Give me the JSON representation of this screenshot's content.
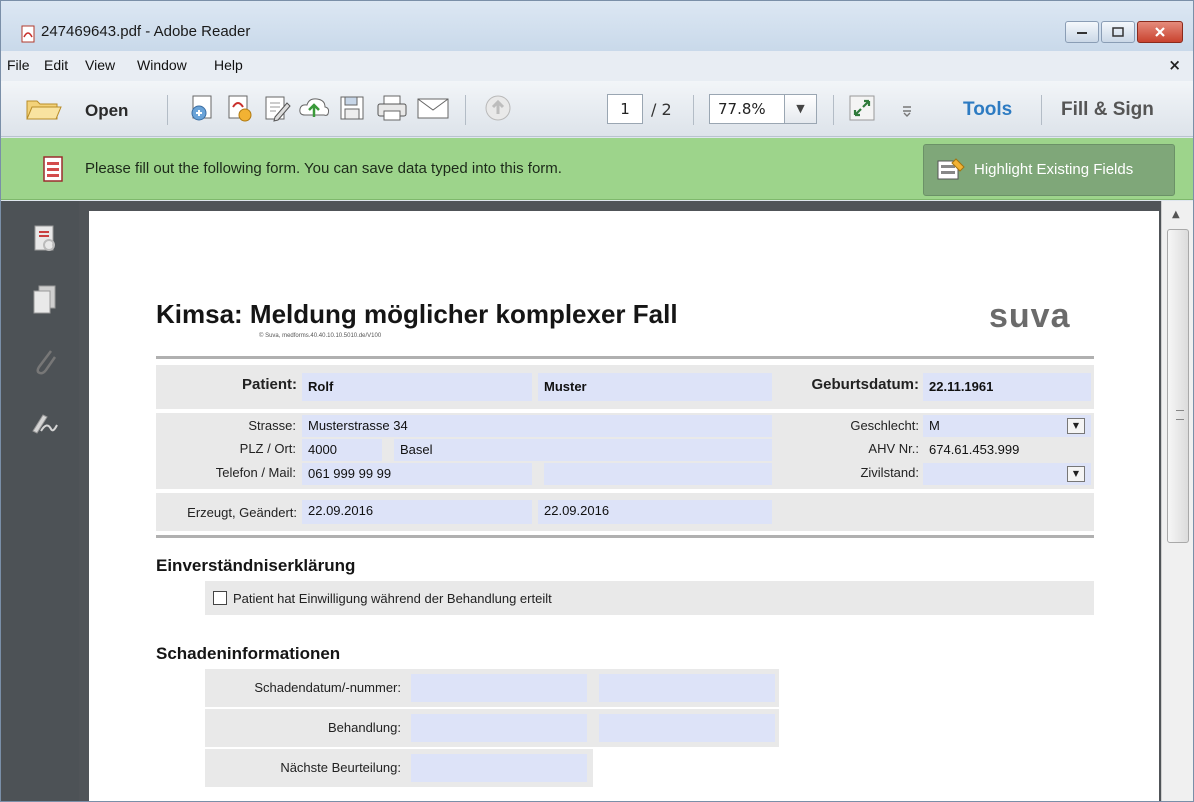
{
  "window": {
    "title": "247469643.pdf - Adobe Reader",
    "accent": "#c9432f"
  },
  "menu": {
    "file": "File",
    "edit": "Edit",
    "view": "View",
    "window": "Window",
    "help": "Help",
    "close_glyph": "×"
  },
  "toolbar": {
    "open_label": "Open",
    "page_current": "1",
    "page_total": "/ 2",
    "zoom": "77.8%",
    "zoom_dropdown_glyph": "▼",
    "tools_label": "Tools",
    "fill_sign_label": "Fill & Sign",
    "tools_color": "#2d7bc2"
  },
  "infobar": {
    "message": "Please fill out the following form. You can save data typed into this form.",
    "highlight_button": "Highlight Existing Fields",
    "background": "#9dd48b"
  },
  "form": {
    "title": "Kimsa: Meldung möglicher komplexer Fall",
    "subtitle": "© Suva, medforms.40.40.10.10.5010.de/V100",
    "logo": "suva",
    "patient": {
      "label": "Patient:",
      "first_name": "Rolf",
      "last_name": "Muster",
      "birth_label": "Geburtsdatum:",
      "birth_value": "22.11.1961",
      "street_label": "Strasse:",
      "street_value": "Musterstrasse 34",
      "plz_label": "PLZ / Ort:",
      "plz_value": "4000",
      "ort_value": "Basel",
      "phone_label": "Telefon / Mail:",
      "phone_value": "061 999 99 99",
      "mail_value": "",
      "gender_label": "Geschlecht:",
      "gender_value": "M",
      "ahv_label": "AHV Nr.:",
      "ahv_value": "674.61.453.999",
      "civil_label": "Zivilstand:",
      "civil_value": "",
      "created_label": "Erzeugt, Geändert:",
      "created_value": "22.09.2016",
      "changed_value": "22.09.2016"
    },
    "consent": {
      "heading": "Einverständniserklärung",
      "checkbox_label": "Patient hat Einwilligung während der Behandlung erteilt",
      "checked": false
    },
    "damage": {
      "heading": "Schadeninformationen",
      "date_label": "Schadendatum/-nummer:",
      "treatment_label": "Behandlung:",
      "next_label": "Nächste Beurteilung:"
    }
  }
}
